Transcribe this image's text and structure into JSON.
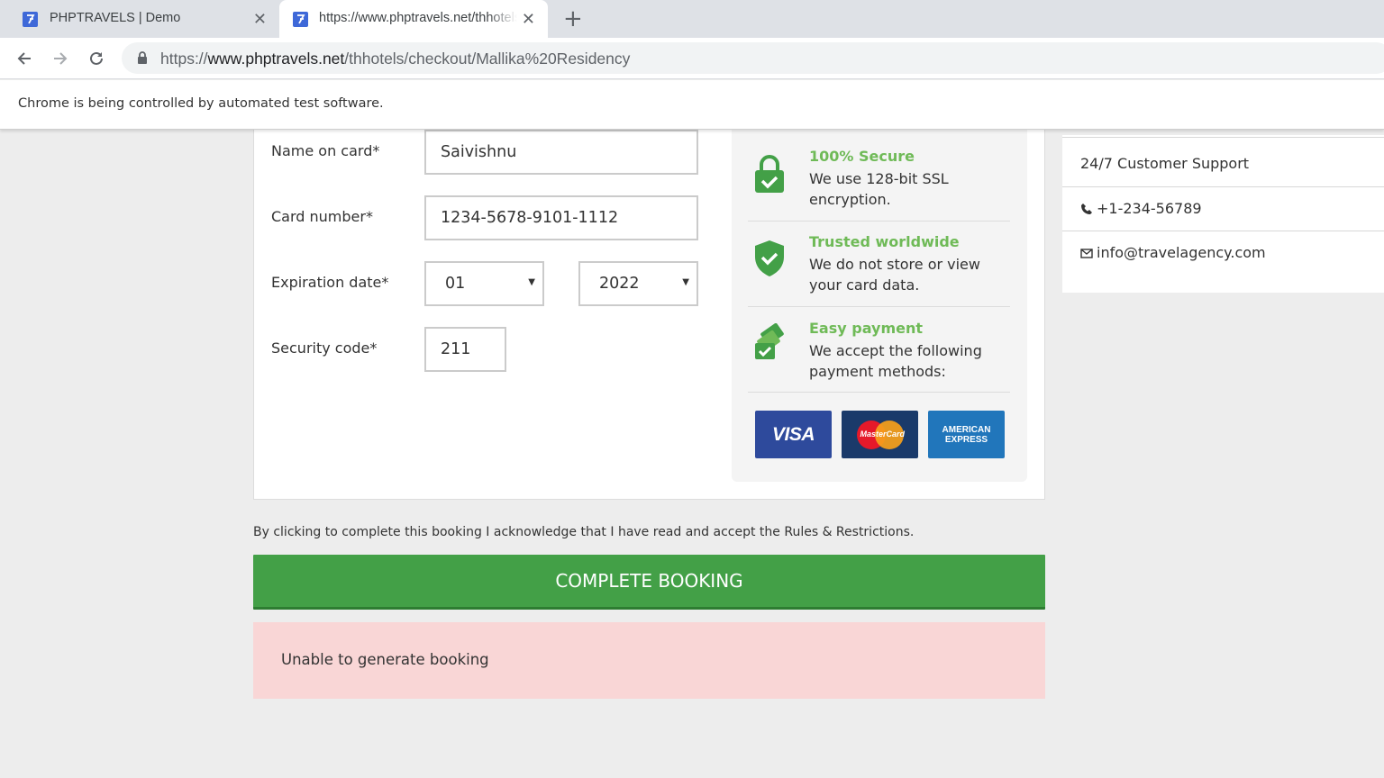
{
  "browser": {
    "tabs": [
      {
        "title": "PHPTRAVELS | Demo",
        "active": false
      },
      {
        "title": "https://www.phptravels.net/thhotels/checkout/Mallika%20Residency",
        "active": true
      }
    ],
    "new_tab_label": "+",
    "close_glyph": "✕",
    "url": {
      "scheme": "https://",
      "host": "www.phptravels.net",
      "path": "/thhotels/checkout/Mallika%20Residency"
    },
    "infobar_text": "Chrome is being controlled by automated test software.",
    "icons": [
      "back-arrow-icon",
      "forward-arrow-icon",
      "reload-icon",
      "lock-icon",
      "favicon-icon",
      "close-icon",
      "plus-icon"
    ]
  },
  "payment_form": {
    "name_label": "Name on card*",
    "name_value": "Saivishnu",
    "card_label": "Card number*",
    "card_value": "1234-5678-9101-1112",
    "expiry_label": "Expiration date*",
    "expiry_month": "01",
    "expiry_year": "2022",
    "security_label": "Security code*",
    "security_value": "211",
    "select_arrow": "▼"
  },
  "security_info": {
    "features": [
      {
        "title": "100% Secure",
        "desc": "We use 128-bit SSL encryption.",
        "icon": "padlock-check-icon"
      },
      {
        "title": "Trusted worldwide",
        "desc": "We do not store or view your card data.",
        "icon": "shield-check-icon"
      },
      {
        "title": "Easy payment",
        "desc": "We accept the following payment methods:",
        "icon": "cards-check-icon"
      }
    ],
    "cards": {
      "visa": "VISA",
      "mastercard": "MasterCard",
      "amex_line1": "AMERICAN",
      "amex_line2": "EXPRESS"
    },
    "accent_color": "#6fba57"
  },
  "sidebar": {
    "support": "24/7 Customer Support",
    "phone": "+1-234-56789",
    "email": "info@travelagency.com",
    "icons": [
      "phone-icon",
      "envelope-icon"
    ]
  },
  "booking": {
    "acknowledgement": "By clicking to complete this booking I acknowledge that I have read and accept the Rules & Restrictions.",
    "complete_button": "COMPLETE BOOKING",
    "button_color": "#43a047",
    "error_message": "Unable to generate booking",
    "error_bg_color": "#f9d6d6"
  }
}
